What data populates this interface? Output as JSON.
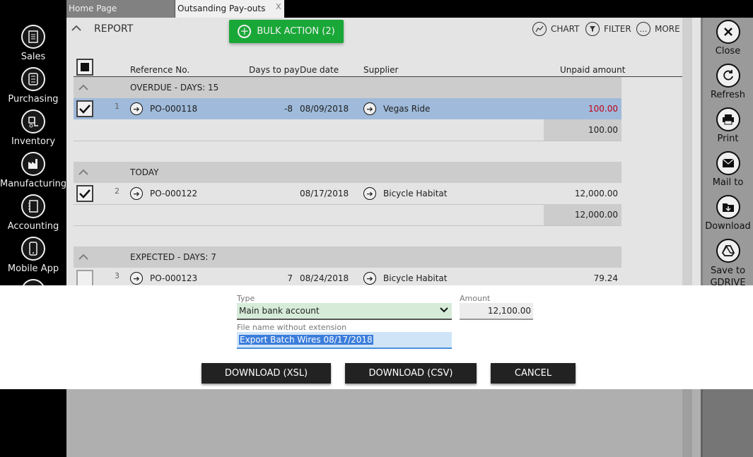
{
  "tabs": [
    {
      "label": "Home Page"
    },
    {
      "label": "Outsanding Pay-outs",
      "close": "x"
    }
  ],
  "nav": [
    {
      "label": "Sales",
      "icon": "sales-icon"
    },
    {
      "label": "Purchasing",
      "icon": "purchasing-icon"
    },
    {
      "label": "Inventory",
      "icon": "inventory-icon"
    },
    {
      "label": "Manufacturing",
      "icon": "manufacturing-icon"
    },
    {
      "label": "Accounting",
      "icon": "accounting-icon"
    },
    {
      "label": "Mobile App",
      "icon": "mobile-icon"
    }
  ],
  "right_panel": [
    {
      "label": "Close",
      "icon": "close-icon"
    },
    {
      "label": "Refresh",
      "icon": "refresh-icon"
    },
    {
      "label": "Print",
      "icon": "print-icon"
    },
    {
      "label": "Mail to",
      "icon": "mail-icon"
    },
    {
      "label": "Download",
      "icon": "download-icon"
    },
    {
      "label": "Save to GDRIVE",
      "icon": "gdrive-icon"
    }
  ],
  "toolbar": {
    "report_label": "REPORT",
    "bulk_action": "BULK ACTION (2)",
    "chart": "CHART",
    "filter": "FILTER",
    "more": "MORE"
  },
  "columns": {
    "reference": "Reference No.",
    "days": "Days to pay",
    "due": "Due date",
    "supplier": "Supplier",
    "unpaid": "Unpaid amount"
  },
  "groups": [
    {
      "title": "OVERDUE - DAYS: 15",
      "rows": [
        {
          "num": "1",
          "ref": "PO-000118",
          "days": "-8",
          "due": "08/09/2018",
          "supplier": "Vegas Ride",
          "amount": "100.00",
          "checked": true,
          "selected": true
        }
      ],
      "subtotal": "100.00"
    },
    {
      "title": "TODAY",
      "rows": [
        {
          "num": "2",
          "ref": "PO-000122",
          "days": "",
          "due": "08/17/2018",
          "supplier": "Bicycle Habitat",
          "amount": "12,000.00",
          "checked": true,
          "selected": false
        }
      ],
      "subtotal": "12,000.00"
    },
    {
      "title": "EXPECTED - DAYS: 7",
      "rows": [
        {
          "num": "3",
          "ref": "PO-000123",
          "days": "7",
          "due": "08/24/2018",
          "supplier": "Bicycle Habitat",
          "amount": "79.24",
          "checked": false,
          "selected": false
        }
      ]
    }
  ],
  "dialog": {
    "type_label": "Type",
    "type_value": "Main bank account",
    "amount_label": "Amount",
    "amount_value": "12,100.00",
    "filename_label": "File name without extension",
    "filename_value": "Export Batch Wires 08/17/2018",
    "download_xsl": "DOWNLOAD (XSL)",
    "download_csv": "DOWNLOAD (CSV)",
    "cancel": "CANCEL"
  },
  "colors": {
    "accent_green": "#1bb33b",
    "selected_row": "#a9c6e8",
    "overdue_red": "#d0021b"
  }
}
